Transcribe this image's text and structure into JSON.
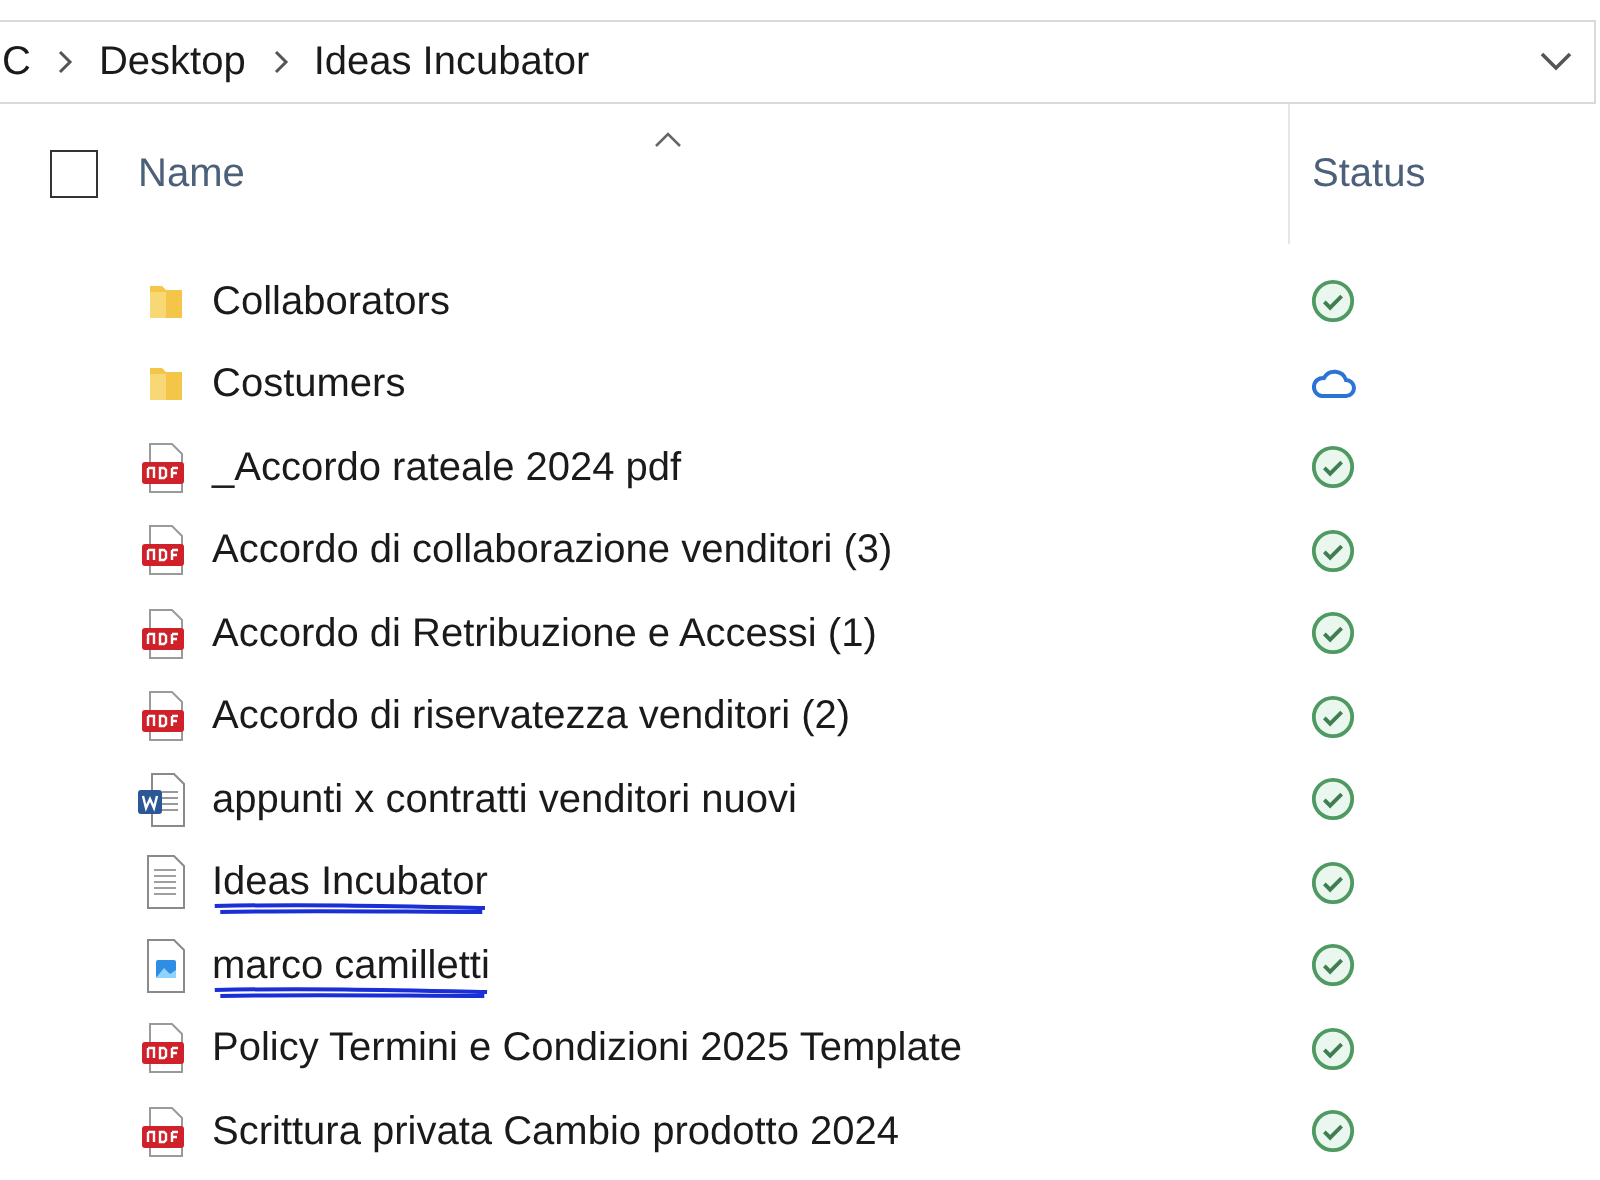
{
  "breadcrumb": [
    "C",
    "Desktop",
    "Ideas Incubator"
  ],
  "columns": {
    "name": "Name",
    "status": "Status",
    "select_all_checked": false
  },
  "files": [
    {
      "name": "Collaborators",
      "kind": "folder",
      "status": {
        "kind": "synced"
      },
      "scribbled": false
    },
    {
      "name": "Costumers",
      "kind": "folder",
      "status": {
        "kind": "cloud"
      },
      "scribbled": false
    },
    {
      "name": "_Accordo rateale 2024 pdf",
      "kind": "pdf",
      "status": {
        "kind": "synced"
      },
      "scribbled": false
    },
    {
      "name": "Accordo di collaborazione venditori (3)",
      "kind": "pdf",
      "status": {
        "kind": "synced"
      },
      "scribbled": false
    },
    {
      "name": "Accordo di Retribuzione e Accessi (1)",
      "kind": "pdf",
      "status": {
        "kind": "synced"
      },
      "scribbled": false
    },
    {
      "name": "Accordo di riservatezza venditori (2)",
      "kind": "pdf",
      "status": {
        "kind": "synced"
      },
      "scribbled": false
    },
    {
      "name": "appunti x contratti venditori nuovi",
      "kind": "word",
      "status": {
        "kind": "synced"
      },
      "scribbled": false
    },
    {
      "name": "Ideas Incubator",
      "kind": "text",
      "status": {
        "kind": "synced"
      },
      "scribbled": true
    },
    {
      "name": "marco camilletti",
      "kind": "image",
      "status": {
        "kind": "synced"
      },
      "scribbled": true
    },
    {
      "name": "Policy Termini e Condizioni 2025 Template",
      "kind": "pdf",
      "status": {
        "kind": "synced"
      },
      "scribbled": false
    },
    {
      "name": "Scrittura privata Cambio prodotto 2024",
      "kind": "pdf",
      "status": {
        "kind": "synced"
      },
      "scribbled": false
    }
  ]
}
